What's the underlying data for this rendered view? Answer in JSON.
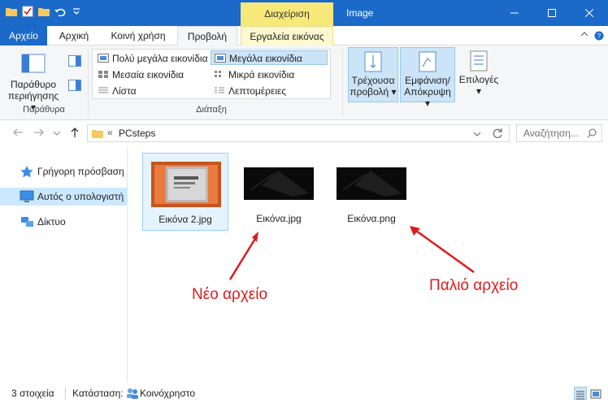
{
  "window": {
    "title": "Image",
    "context_tab": "Διαχείριση"
  },
  "tabs": [
    {
      "label": "Αρχείο"
    },
    {
      "label": "Αρχική"
    },
    {
      "label": "Κοινή χρήση"
    },
    {
      "label": "Προβολή"
    },
    {
      "label": "Εργαλεία εικόνας"
    }
  ],
  "ribbon": {
    "panes_group": {
      "label": "Παράθυρα",
      "nav_pane_line1": "Παράθυρο",
      "nav_pane_line2": "περιήγησης ▾"
    },
    "layout_group": {
      "label": "Διάταξη",
      "items": [
        {
          "label": "Πολύ μεγάλα εικονίδια"
        },
        {
          "label": "Μεγάλα εικονίδια"
        },
        {
          "label": "Μεσαία εικονίδια"
        },
        {
          "label": "Μικρά εικονίδια"
        },
        {
          "label": "Λίστα"
        },
        {
          "label": "Λεπτομέρειες"
        }
      ]
    },
    "current_view": {
      "line1": "Τρέχουσα",
      "line2": "προβολή ▾"
    },
    "show_hide": {
      "line1": "Εμφάνιση/",
      "line2": "Απόκρυψη ▾"
    },
    "options": {
      "line1": "Επιλογές",
      "line2": "▾"
    }
  },
  "address": {
    "chevrons": "«",
    "path": "PCsteps",
    "search_placeholder": "Αναζήτηση..."
  },
  "nav_pane": {
    "items": [
      {
        "label": "Γρήγορη πρόσβαση"
      },
      {
        "label": "Αυτός ο υπολογιστή"
      },
      {
        "label": "Δίκτυο"
      }
    ]
  },
  "files": [
    {
      "name": "Εικόνα 2.jpg"
    },
    {
      "name": "Εικόνα.jpg"
    },
    {
      "name": "Εικόνα.png"
    }
  ],
  "annotations": {
    "new_file": "Νέο αρχείο",
    "old_file": "Παλιό αρχείο"
  },
  "status": {
    "count": "3 στοιχεία",
    "state_label": "Κατάσταση:",
    "state_value": "Κοινόχρηστο"
  },
  "colors": {
    "accent": "#1b6ac9",
    "context": "#f6e97a",
    "annotation": "#e2191c"
  }
}
